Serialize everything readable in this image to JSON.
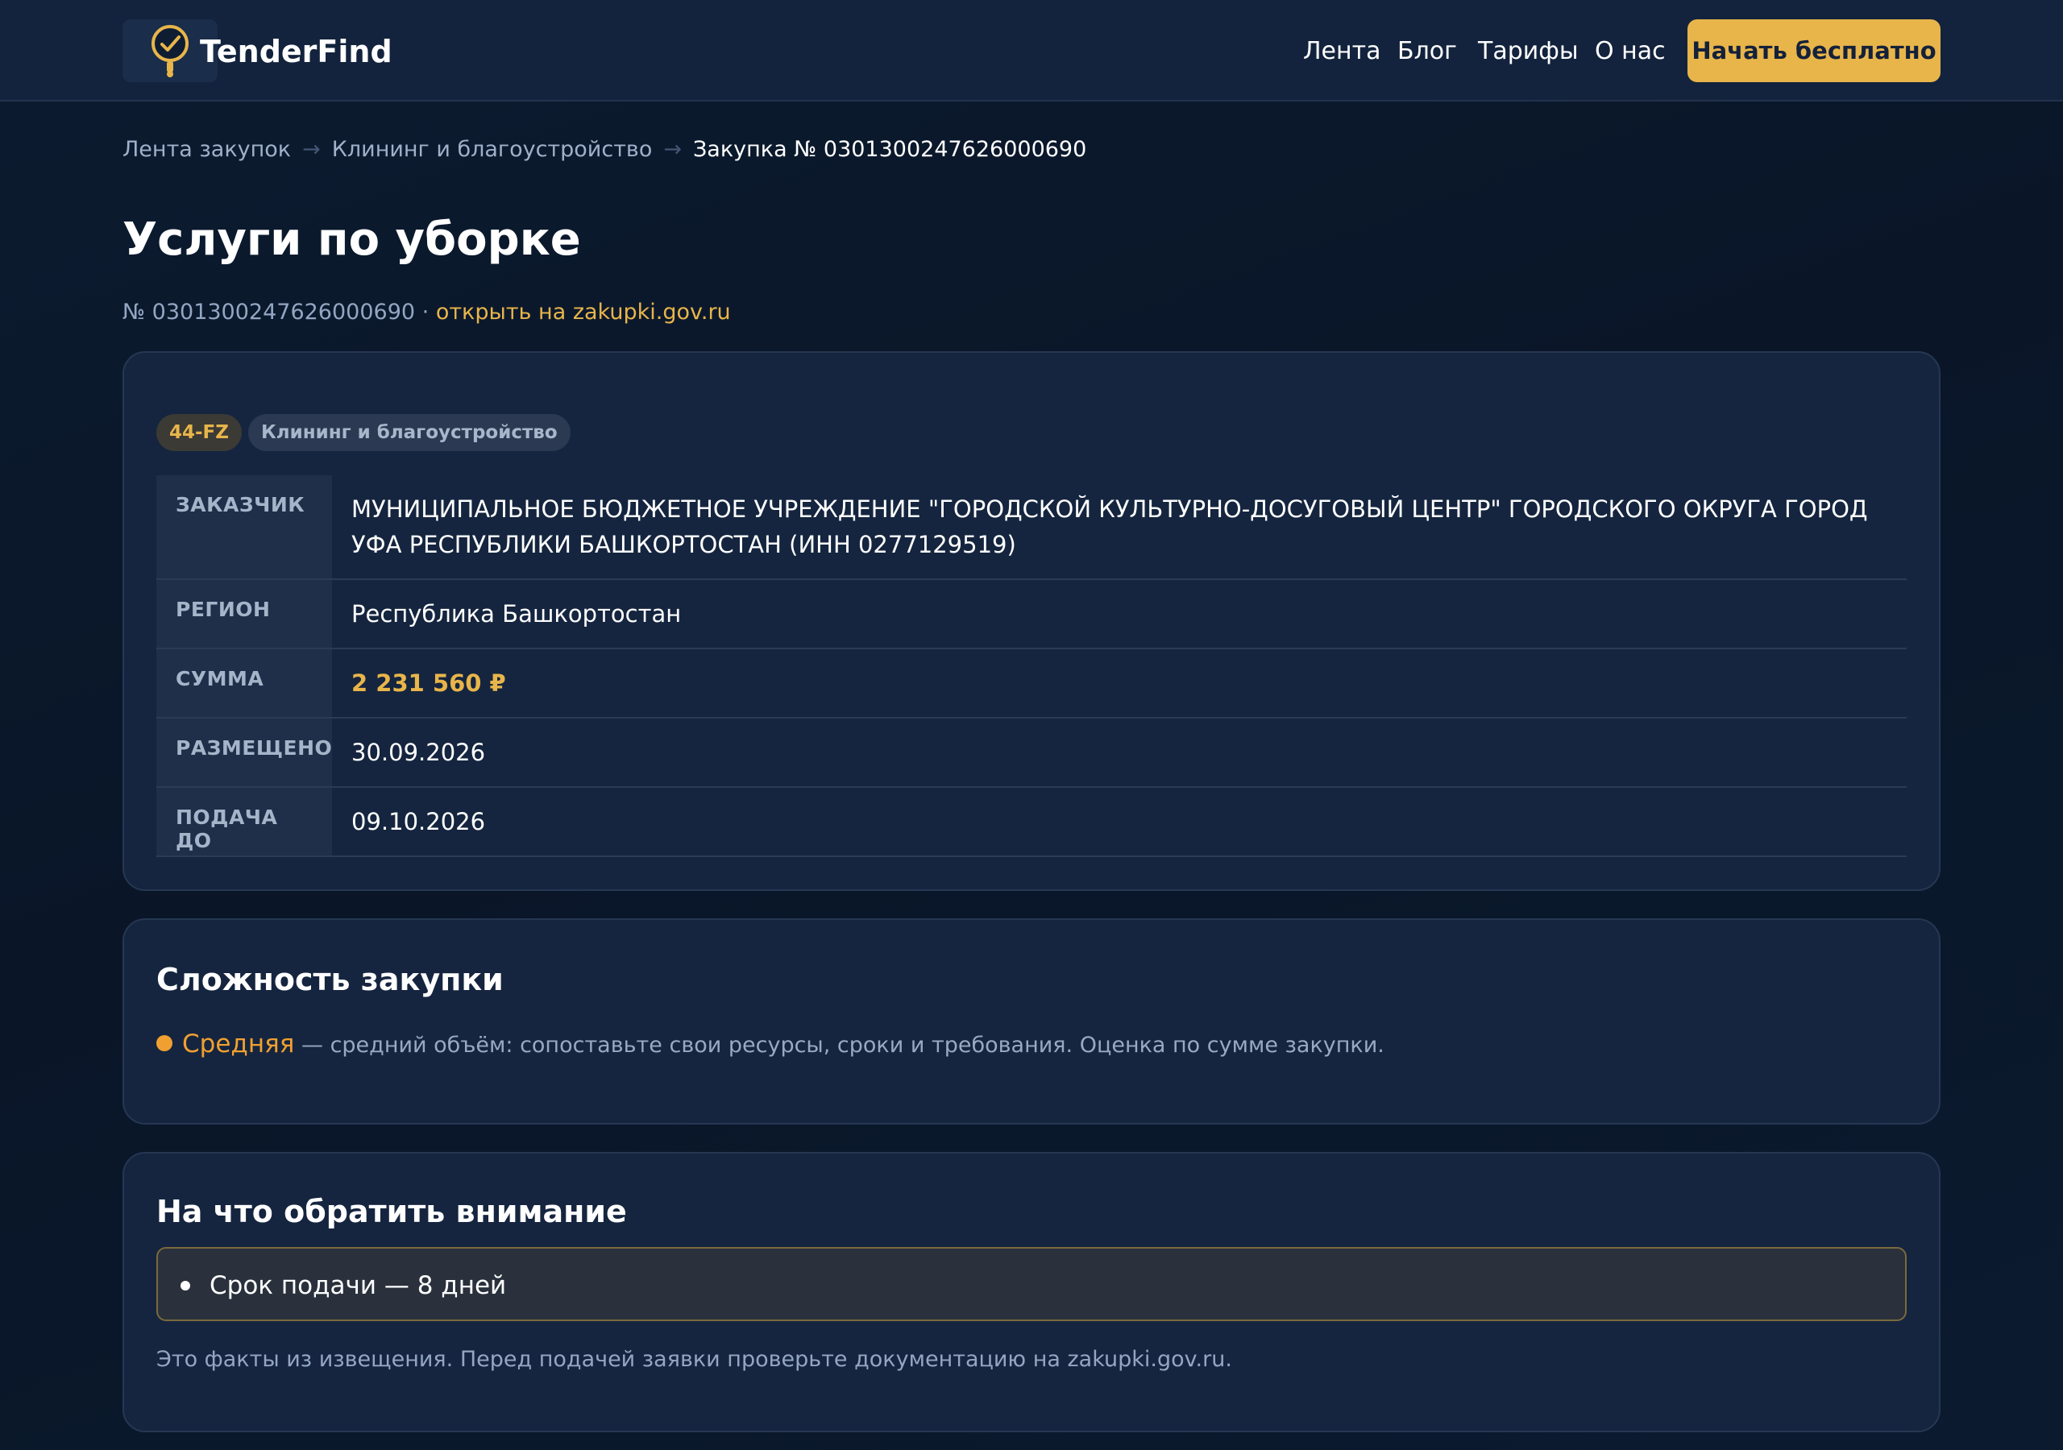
{
  "header": {
    "brand": "TenderFind",
    "nav": [
      "Лента",
      "Блог",
      "Тарифы",
      "О нас"
    ],
    "cta": "Начать бесплатно"
  },
  "breadcrumbs": {
    "items": [
      "Лента закупок",
      "Клининг и благоустройство"
    ],
    "current": "Закупка № 0301300247626000690",
    "separator": "→"
  },
  "page": {
    "title": "Услуги по уборке",
    "number": "№ 0301300247626000690",
    "meta_sep": " · ",
    "open_link": "открыть на zakupki.gov.ru"
  },
  "badges": {
    "law": "44-FZ",
    "category": "Клининг и благоустройство"
  },
  "details": {
    "customer_label": "ЗАКАЗЧИК",
    "customer_value": "МУНИЦИПАЛЬНОЕ БЮДЖЕТНОЕ УЧРЕЖДЕНИЕ \"ГОРОДСКОЙ КУЛЬТУРНО-ДОСУГОВЫЙ ЦЕНТР\" ГОРОДСКОГО ОКРУГА ГОРОД УФА РЕСПУБЛИКИ БАШКОРТОСТАН (ИНН 0277129519)",
    "region_label": "РЕГИОН",
    "region_value": "Республика Башкортостан",
    "amount_label": "СУММА",
    "amount_value": "2 231 560 ₽",
    "posted_label": "РАЗМЕЩЕНО",
    "posted_value": "30.09.2026",
    "deadline_label": "ПОДАЧА ДО",
    "deadline_value": "09.10.2026"
  },
  "complexity": {
    "title": "Сложность закупки",
    "level": "Средняя",
    "description": " — средний объём: сопоставьте свои ресурсы, сроки и требования. Оценка по сумме закупки.",
    "level_color": "#f0a030"
  },
  "attention": {
    "title": "На что обратить внимание",
    "items": [
      "Срок подачи — 8 дней"
    ],
    "footnote": "Это факты из извещения. Перед подачей заявки проверьте документацию на zakupki.gov.ru."
  },
  "colors": {
    "accent": "#e8b54a",
    "background": "#0a1628",
    "card": "#15253f"
  },
  "icons": {
    "logo": "clock-magnifier-icon"
  }
}
